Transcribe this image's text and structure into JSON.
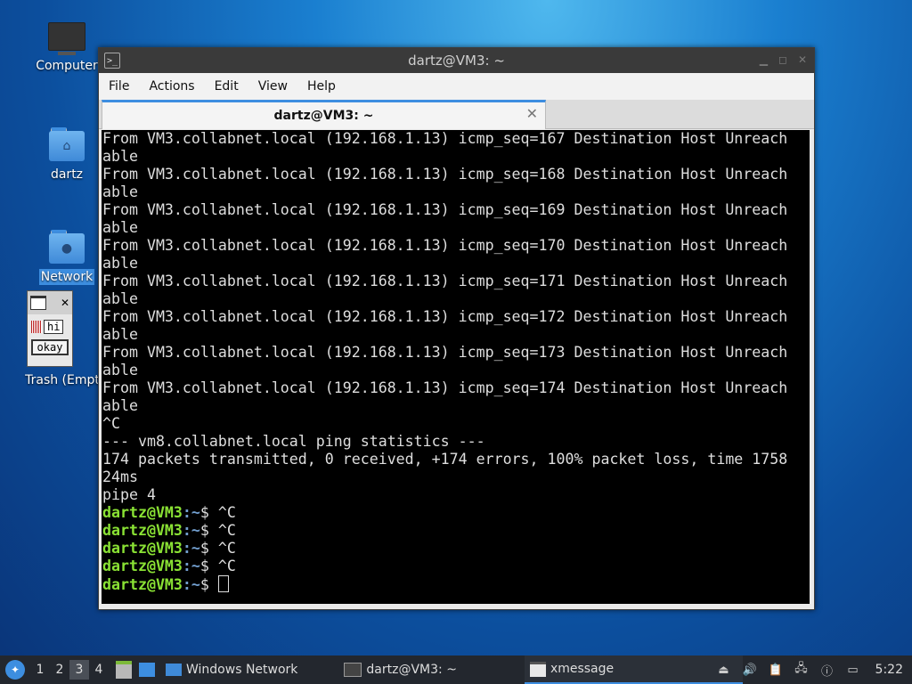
{
  "desktop": {
    "icons": [
      {
        "label": "Computer"
      },
      {
        "label": "dartz"
      },
      {
        "label": "Network"
      },
      {
        "label": "Trash (Empt"
      }
    ]
  },
  "xmessage": {
    "message": "hi",
    "button": "okay"
  },
  "window": {
    "title": "dartz@VM3: ~",
    "menu": [
      "File",
      "Actions",
      "Edit",
      "View",
      "Help"
    ],
    "tab_label": "dartz@VM3: ~"
  },
  "terminal": {
    "output_lines": [
      "From VM3.collabnet.local (192.168.1.13) icmp_seq=167 Destination Host Unreach",
      "able",
      "From VM3.collabnet.local (192.168.1.13) icmp_seq=168 Destination Host Unreach",
      "able",
      "From VM3.collabnet.local (192.168.1.13) icmp_seq=169 Destination Host Unreach",
      "able",
      "From VM3.collabnet.local (192.168.1.13) icmp_seq=170 Destination Host Unreach",
      "able",
      "From VM3.collabnet.local (192.168.1.13) icmp_seq=171 Destination Host Unreach",
      "able",
      "From VM3.collabnet.local (192.168.1.13) icmp_seq=172 Destination Host Unreach",
      "able",
      "From VM3.collabnet.local (192.168.1.13) icmp_seq=173 Destination Host Unreach",
      "able",
      "From VM3.collabnet.local (192.168.1.13) icmp_seq=174 Destination Host Unreach",
      "able",
      "^C",
      "--- vm8.collabnet.local ping statistics ---",
      "174 packets transmitted, 0 received, +174 errors, 100% packet loss, time 1758",
      "24ms",
      "pipe 4"
    ],
    "prompt_user": "dartz@VM3",
    "prompt_path": ":~",
    "prompt_symbol": "$ ",
    "prompt_commands": [
      "^C",
      "^C",
      "^C",
      "^C",
      ""
    ]
  },
  "taskbar": {
    "workspaces": [
      "1",
      "2",
      "3",
      "4"
    ],
    "active_workspace": "3",
    "tasks": [
      {
        "label": "Windows Network"
      },
      {
        "label": "dartz@VM3: ~"
      },
      {
        "label": "xmessage"
      }
    ],
    "clock": "5:22"
  },
  "colors": {
    "accent": "#3d8ee0",
    "prompt_green": "#8ae234",
    "prompt_blue": "#729fcf"
  }
}
